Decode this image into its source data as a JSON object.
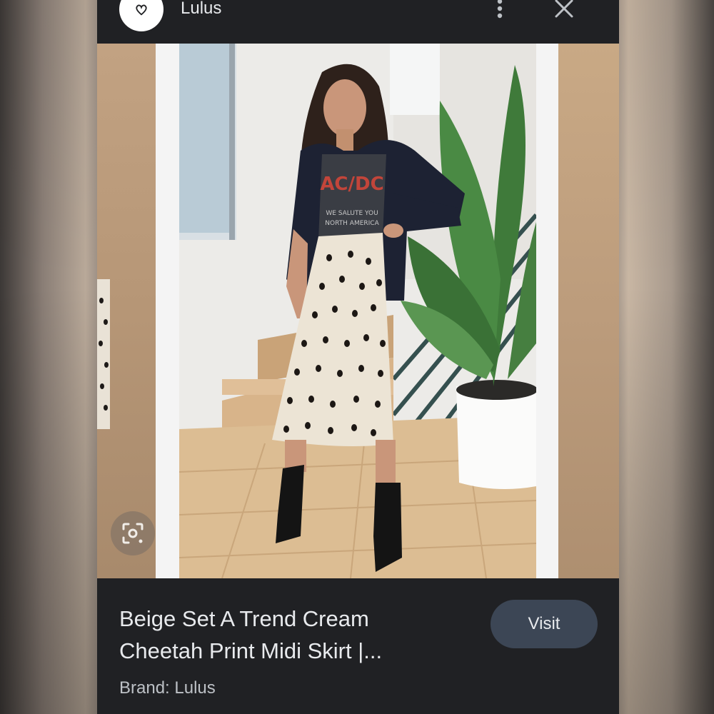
{
  "header": {
    "site_name": "Lulus",
    "logo_icon": "heart-icon",
    "menu_icon": "more-vert-icon",
    "close_icon": "close-icon"
  },
  "image": {
    "lens_icon": "google-lens-icon",
    "shirt_text": [
      "AC/DC",
      "WE SALUTE YOU",
      "NORTH AMERICA"
    ]
  },
  "result": {
    "title_line1": "Beige Set A Trend Cream",
    "title_line2": "Cheetah Print Midi Skirt |...",
    "brand": "Brand: Lulus",
    "visit_label": "Visit"
  },
  "colors": {
    "panel": "#202124",
    "text": "#e8eaed",
    "secondary_text": "#bdc1c6",
    "visit_button": "#3c4655"
  }
}
